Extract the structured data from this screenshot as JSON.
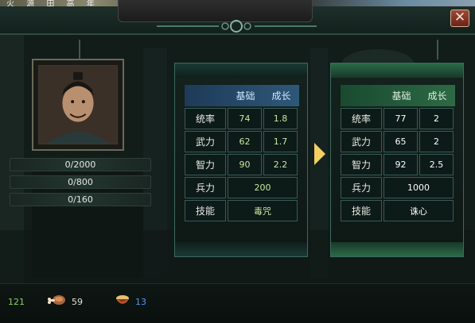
{
  "top_strip_text": "火 源 田 高 年",
  "portrait": {
    "icon": "general-portrait"
  },
  "bars": [
    "0/2000",
    "0/800",
    "0/160"
  ],
  "left_panel": {
    "headers": [
      "基础",
      "成长"
    ],
    "rows": [
      {
        "label": "统率",
        "base": "74",
        "growth": "1.8"
      },
      {
        "label": "武力",
        "base": "62",
        "growth": "1.7"
      },
      {
        "label": "智力",
        "base": "90",
        "growth": "2.2"
      }
    ],
    "troops": {
      "label": "兵力",
      "value": "200"
    },
    "skill": {
      "label": "技能",
      "value": "毒咒"
    }
  },
  "right_panel": {
    "headers": [
      "基础",
      "成长"
    ],
    "rows": [
      {
        "label": "统率",
        "base": "77",
        "growth": "2"
      },
      {
        "label": "武力",
        "base": "65",
        "growth": "2"
      },
      {
        "label": "智力",
        "base": "92",
        "growth": "2.5"
      }
    ],
    "troops": {
      "label": "兵力",
      "value": "1000"
    },
    "skill": {
      "label": "技能",
      "value": "诛心"
    }
  },
  "close_glyph": "✕",
  "resources": {
    "gold": "121",
    "meat": "59",
    "food": "13"
  },
  "colors": {
    "arrow": "#f4d060",
    "food_value": "#4a9aff",
    "gold_value": "#8ad060"
  }
}
